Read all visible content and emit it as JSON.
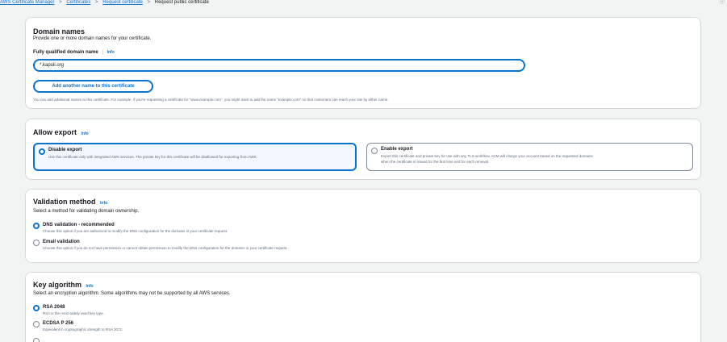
{
  "breadcrumb": {
    "items": [
      "AWS Certificate Manager",
      "Certificates",
      "Request certificate"
    ],
    "separator": ">",
    "current": "Request public certificate"
  },
  "top_right_glyph": "ⓘ",
  "domain_names": {
    "title": "Domain names",
    "description": "Provide one or more domain names for your certificate.",
    "field_label": "Fully qualified domain name",
    "info": "Info",
    "input_value": "*.kapuli.org",
    "add_button": "Add another name to this certificate",
    "hint": "You can add additional names to this certificate. For example, if you're requesting a certificate for \"www.example.com\", you might want to add the name \"example.com\" so that customers can reach your site by either name."
  },
  "allow_export": {
    "title": "Allow export",
    "info": "Info",
    "options": [
      {
        "label": "Disable export",
        "description": "Use this certificate only with integrated AWS services. The private key for this certificate will be disallowed for exporting from AWS.",
        "selected": true
      },
      {
        "label": "Enable export",
        "description_line1": "Export this certificate and private key for use with any TLS workflow. ACM will charge your account based on the requested domains",
        "description_line2": "when the certificate is issued for the first time and for each renewal.",
        "selected": false
      }
    ]
  },
  "validation_method": {
    "title": "Validation method",
    "info": "Info",
    "description": "Select a method for validating domain ownership.",
    "options": [
      {
        "label": "DNS validation - recommended",
        "description": "Choose this option if you are authorized to modify the DNS configuration for the domains in your certificate request.",
        "selected": true
      },
      {
        "label": "Email validation",
        "description": "Choose this option if you do not have permission or cannot obtain permission to modify the DNS configuration for the domains in your certificate request.",
        "selected": false
      }
    ]
  },
  "key_algorithm": {
    "title": "Key algorithm",
    "info": "Info",
    "description": "Select an encryption algorithm. Some algorithms may not be supported by all AWS services.",
    "options": [
      {
        "label": "RSA 2048",
        "description": "RSA is the most widely used key type.",
        "selected": true
      },
      {
        "label": "ECDSA P 256",
        "description": "Equivalent in cryptographic strength to RSA 3072.",
        "selected": false
      }
    ]
  },
  "colors": {
    "accent": "#0972d3",
    "selected_tile_bg": "#f2f8fd",
    "border": "#d5dbdb",
    "page_bg": "#f2f3f3"
  }
}
